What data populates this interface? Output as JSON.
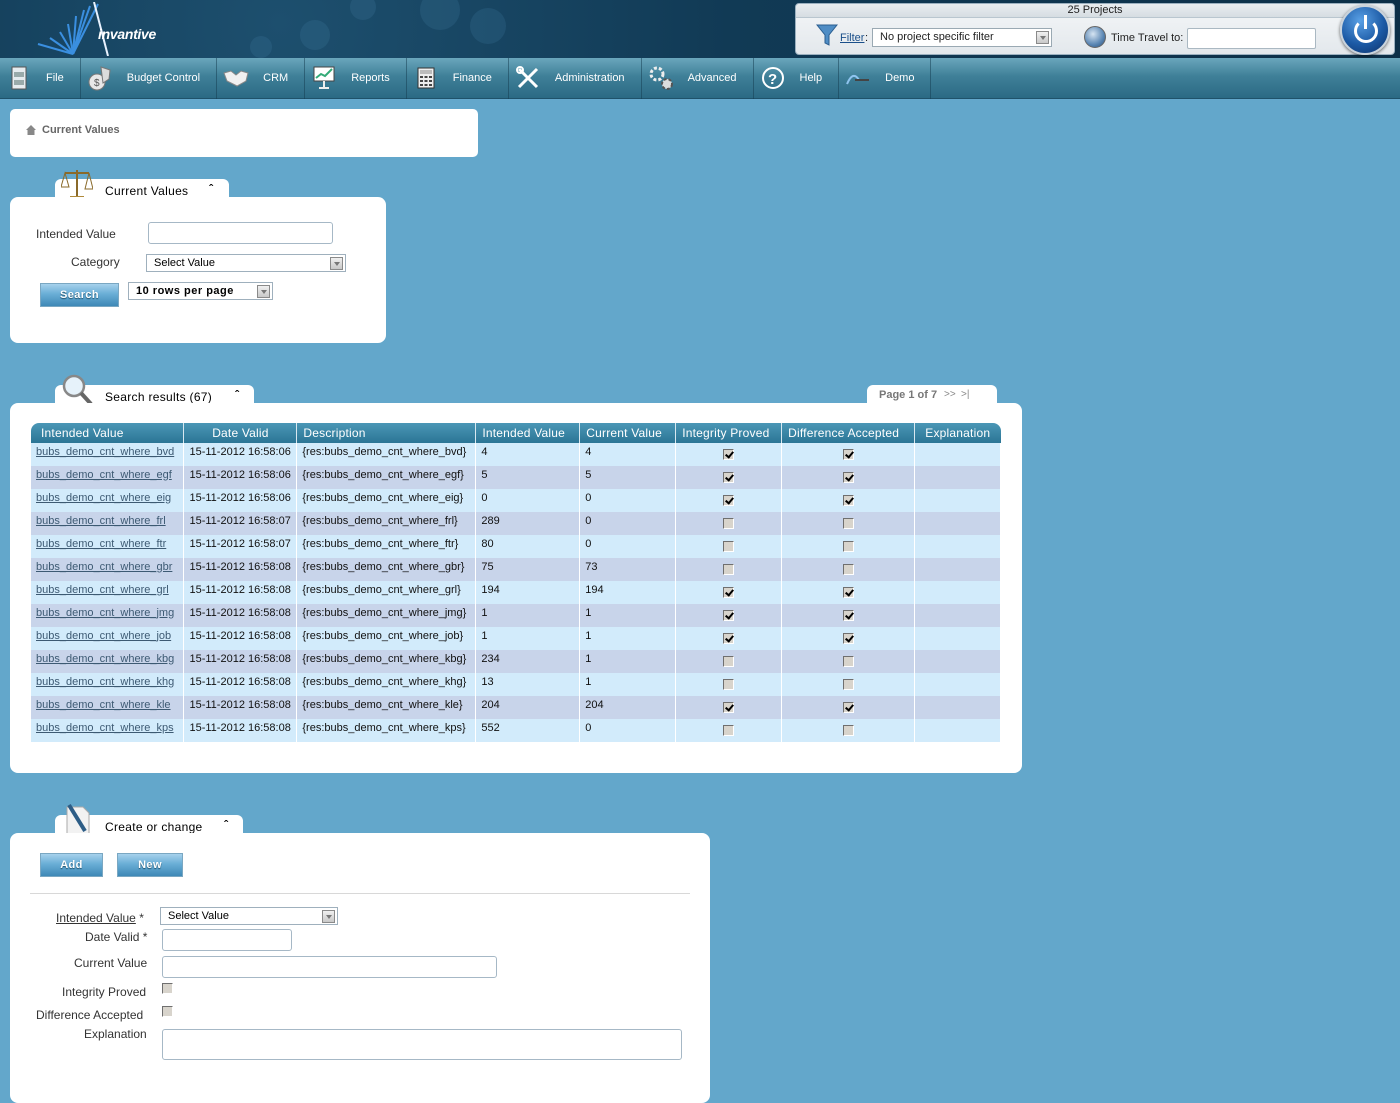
{
  "header": {
    "logo_text": "invantive",
    "projects_title": "25 Projects",
    "filter_label": "Filter",
    "filter_colon": ":",
    "filter_value": "No project specific filter",
    "time_travel_label": "Time Travel to:",
    "time_travel_value": ""
  },
  "menu": {
    "items": [
      {
        "label": "File",
        "icon": "cabinet-icon"
      },
      {
        "label": "Budget Control",
        "icon": "money-bag-icon"
      },
      {
        "label": "CRM",
        "icon": "handshake-icon"
      },
      {
        "label": "Reports",
        "icon": "presentation-icon"
      },
      {
        "label": "Finance",
        "icon": "calculator-icon"
      },
      {
        "label": "Administration",
        "icon": "tools-icon"
      },
      {
        "label": "Advanced",
        "icon": "gears-icon"
      },
      {
        "label": "Help",
        "icon": "help-icon"
      },
      {
        "label": "Demo",
        "icon": "demo-logo-icon"
      }
    ]
  },
  "breadcrumb": {
    "label": "Current Values"
  },
  "search_panel": {
    "title": "Current Values",
    "intended_value_label": "Intended Value",
    "intended_value_value": "",
    "category_label": "Category",
    "category_value": "Select Value",
    "search_button": "Search",
    "rows_per_page": "10 rows per page"
  },
  "results_panel": {
    "title": "Search results (67)",
    "pager_text": "Page 1 of 7",
    "pager_next": ">>",
    "pager_last": ">|",
    "columns": [
      "Intended Value",
      "Date Valid",
      "Description",
      "Intended Value",
      "Current Value",
      "Integrity Proved",
      "Difference Accepted",
      "Explanation"
    ],
    "rows": [
      {
        "intended": "bubs_demo_cnt_where_bvd",
        "date": "15-11-2012 16:58:06",
        "description": "{res:bubs_demo_cnt_where_bvd}",
        "intended_value": "4",
        "current_value": "4",
        "integrity": true,
        "accepted": true,
        "explanation": ""
      },
      {
        "intended": "bubs_demo_cnt_where_egf",
        "date": "15-11-2012 16:58:06",
        "description": "{res:bubs_demo_cnt_where_egf}",
        "intended_value": "5",
        "current_value": "5",
        "integrity": true,
        "accepted": true,
        "explanation": ""
      },
      {
        "intended": "bubs_demo_cnt_where_eig",
        "date": "15-11-2012 16:58:06",
        "description": "{res:bubs_demo_cnt_where_eig}",
        "intended_value": "0",
        "current_value": "0",
        "integrity": true,
        "accepted": true,
        "explanation": ""
      },
      {
        "intended": "bubs_demo_cnt_where_frl",
        "date": "15-11-2012 16:58:07",
        "description": "{res:bubs_demo_cnt_where_frl}",
        "intended_value": "289",
        "current_value": "0",
        "integrity": false,
        "accepted": false,
        "explanation": ""
      },
      {
        "intended": "bubs_demo_cnt_where_ftr",
        "date": "15-11-2012 16:58:07",
        "description": "{res:bubs_demo_cnt_where_ftr}",
        "intended_value": "80",
        "current_value": "0",
        "integrity": false,
        "accepted": false,
        "explanation": ""
      },
      {
        "intended": "bubs_demo_cnt_where_gbr",
        "date": "15-11-2012 16:58:08",
        "description": "{res:bubs_demo_cnt_where_gbr}",
        "intended_value": "75",
        "current_value": "73",
        "integrity": false,
        "accepted": false,
        "explanation": ""
      },
      {
        "intended": "bubs_demo_cnt_where_grl",
        "date": "15-11-2012 16:58:08",
        "description": "{res:bubs_demo_cnt_where_grl}",
        "intended_value": "194",
        "current_value": "194",
        "integrity": true,
        "accepted": true,
        "explanation": ""
      },
      {
        "intended": "bubs_demo_cnt_where_jmg",
        "date": "15-11-2012 16:58:08",
        "description": "{res:bubs_demo_cnt_where_jmg}",
        "intended_value": "1",
        "current_value": "1",
        "integrity": true,
        "accepted": true,
        "explanation": ""
      },
      {
        "intended": "bubs_demo_cnt_where_job",
        "date": "15-11-2012 16:58:08",
        "description": "{res:bubs_demo_cnt_where_job}",
        "intended_value": "1",
        "current_value": "1",
        "integrity": true,
        "accepted": true,
        "explanation": ""
      },
      {
        "intended": "bubs_demo_cnt_where_kbg",
        "date": "15-11-2012 16:58:08",
        "description": "{res:bubs_demo_cnt_where_kbg}",
        "intended_value": "234",
        "current_value": "1",
        "integrity": false,
        "accepted": false,
        "explanation": ""
      },
      {
        "intended": "bubs_demo_cnt_where_khg",
        "date": "15-11-2012 16:58:08",
        "description": "{res:bubs_demo_cnt_where_khg}",
        "intended_value": "13",
        "current_value": "1",
        "integrity": false,
        "accepted": false,
        "explanation": ""
      },
      {
        "intended": "bubs_demo_cnt_where_kle",
        "date": "15-11-2012 16:58:08",
        "description": "{res:bubs_demo_cnt_where_kle}",
        "intended_value": "204",
        "current_value": "204",
        "integrity": true,
        "accepted": true,
        "explanation": ""
      },
      {
        "intended": "bubs_demo_cnt_where_kps",
        "date": "15-11-2012 16:58:08",
        "description": "{res:bubs_demo_cnt_where_kps}",
        "intended_value": "552",
        "current_value": "0",
        "integrity": false,
        "accepted": false,
        "explanation": ""
      }
    ]
  },
  "create_panel": {
    "title": "Create or change",
    "add_button": "Add",
    "new_button": "New",
    "intended_value_label": "Intended Value",
    "required_mark": "*",
    "intended_value_select": "Select Value",
    "date_valid_label": "Date Valid *",
    "date_valid_value": "",
    "current_value_label": "Current Value",
    "current_value_value": "",
    "integrity_label": "Integrity Proved",
    "integrity_checked": false,
    "accepted_label": "Difference Accepted",
    "accepted_checked": false,
    "explanation_label": "Explanation",
    "explanation_value": ""
  }
}
